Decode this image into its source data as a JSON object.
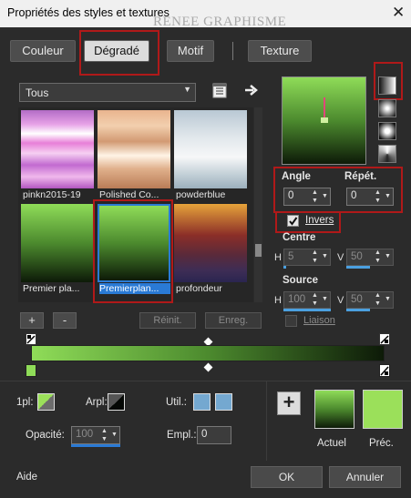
{
  "window": {
    "title": "Propriétés des styles et textures",
    "watermark": "RENEE GRAPHISME",
    "close": "✕"
  },
  "tabs": [
    {
      "label": "Couleur"
    },
    {
      "label": "Dégradé"
    },
    {
      "label": "Motif"
    },
    {
      "label": "Texture"
    }
  ],
  "category": {
    "value": "Tous"
  },
  "gradients": [
    {
      "name": "pinkn2015-19"
    },
    {
      "name": "Polished Co..."
    },
    {
      "name": "powderblue"
    },
    {
      "name": "Premier pla..."
    },
    {
      "name": "Premierplan..."
    },
    {
      "name": "profondeur"
    }
  ],
  "library_buttons": {
    "add": "+",
    "remove": "-",
    "reset": "Réinit.",
    "save": "Enreg."
  },
  "angle": {
    "label": "Angle",
    "value": "0"
  },
  "repeat": {
    "label": "Répét.",
    "value": "0"
  },
  "invert": {
    "label": "Invers",
    "checked": true
  },
  "center": {
    "label": "Centre",
    "h_label": "H",
    "h_value": "5",
    "v_label": "V",
    "v_value": "50"
  },
  "source": {
    "label": "Source",
    "h_label": "H",
    "h_value": "100",
    "v_label": "V",
    "v_value": "50"
  },
  "link": {
    "label": "Liaison"
  },
  "markers": {
    "first": "1pl:",
    "bg": "Arpl:",
    "user": "Util.:"
  },
  "opacity": {
    "label": "Opacité:",
    "value": "100"
  },
  "location": {
    "label": "Empl.:",
    "value": "0"
  },
  "preview": {
    "current": "Actuel",
    "previous": "Préc.",
    "add": "+"
  },
  "footer": {
    "help": "Aide",
    "ok": "OK",
    "cancel": "Annuler"
  },
  "colors": {
    "fg_green": "#8fdc58",
    "dark": "#0d1a08",
    "accent_red": "#b01919",
    "select_blue": "#2a7ad5",
    "link_blue": "#4ba0e0"
  }
}
